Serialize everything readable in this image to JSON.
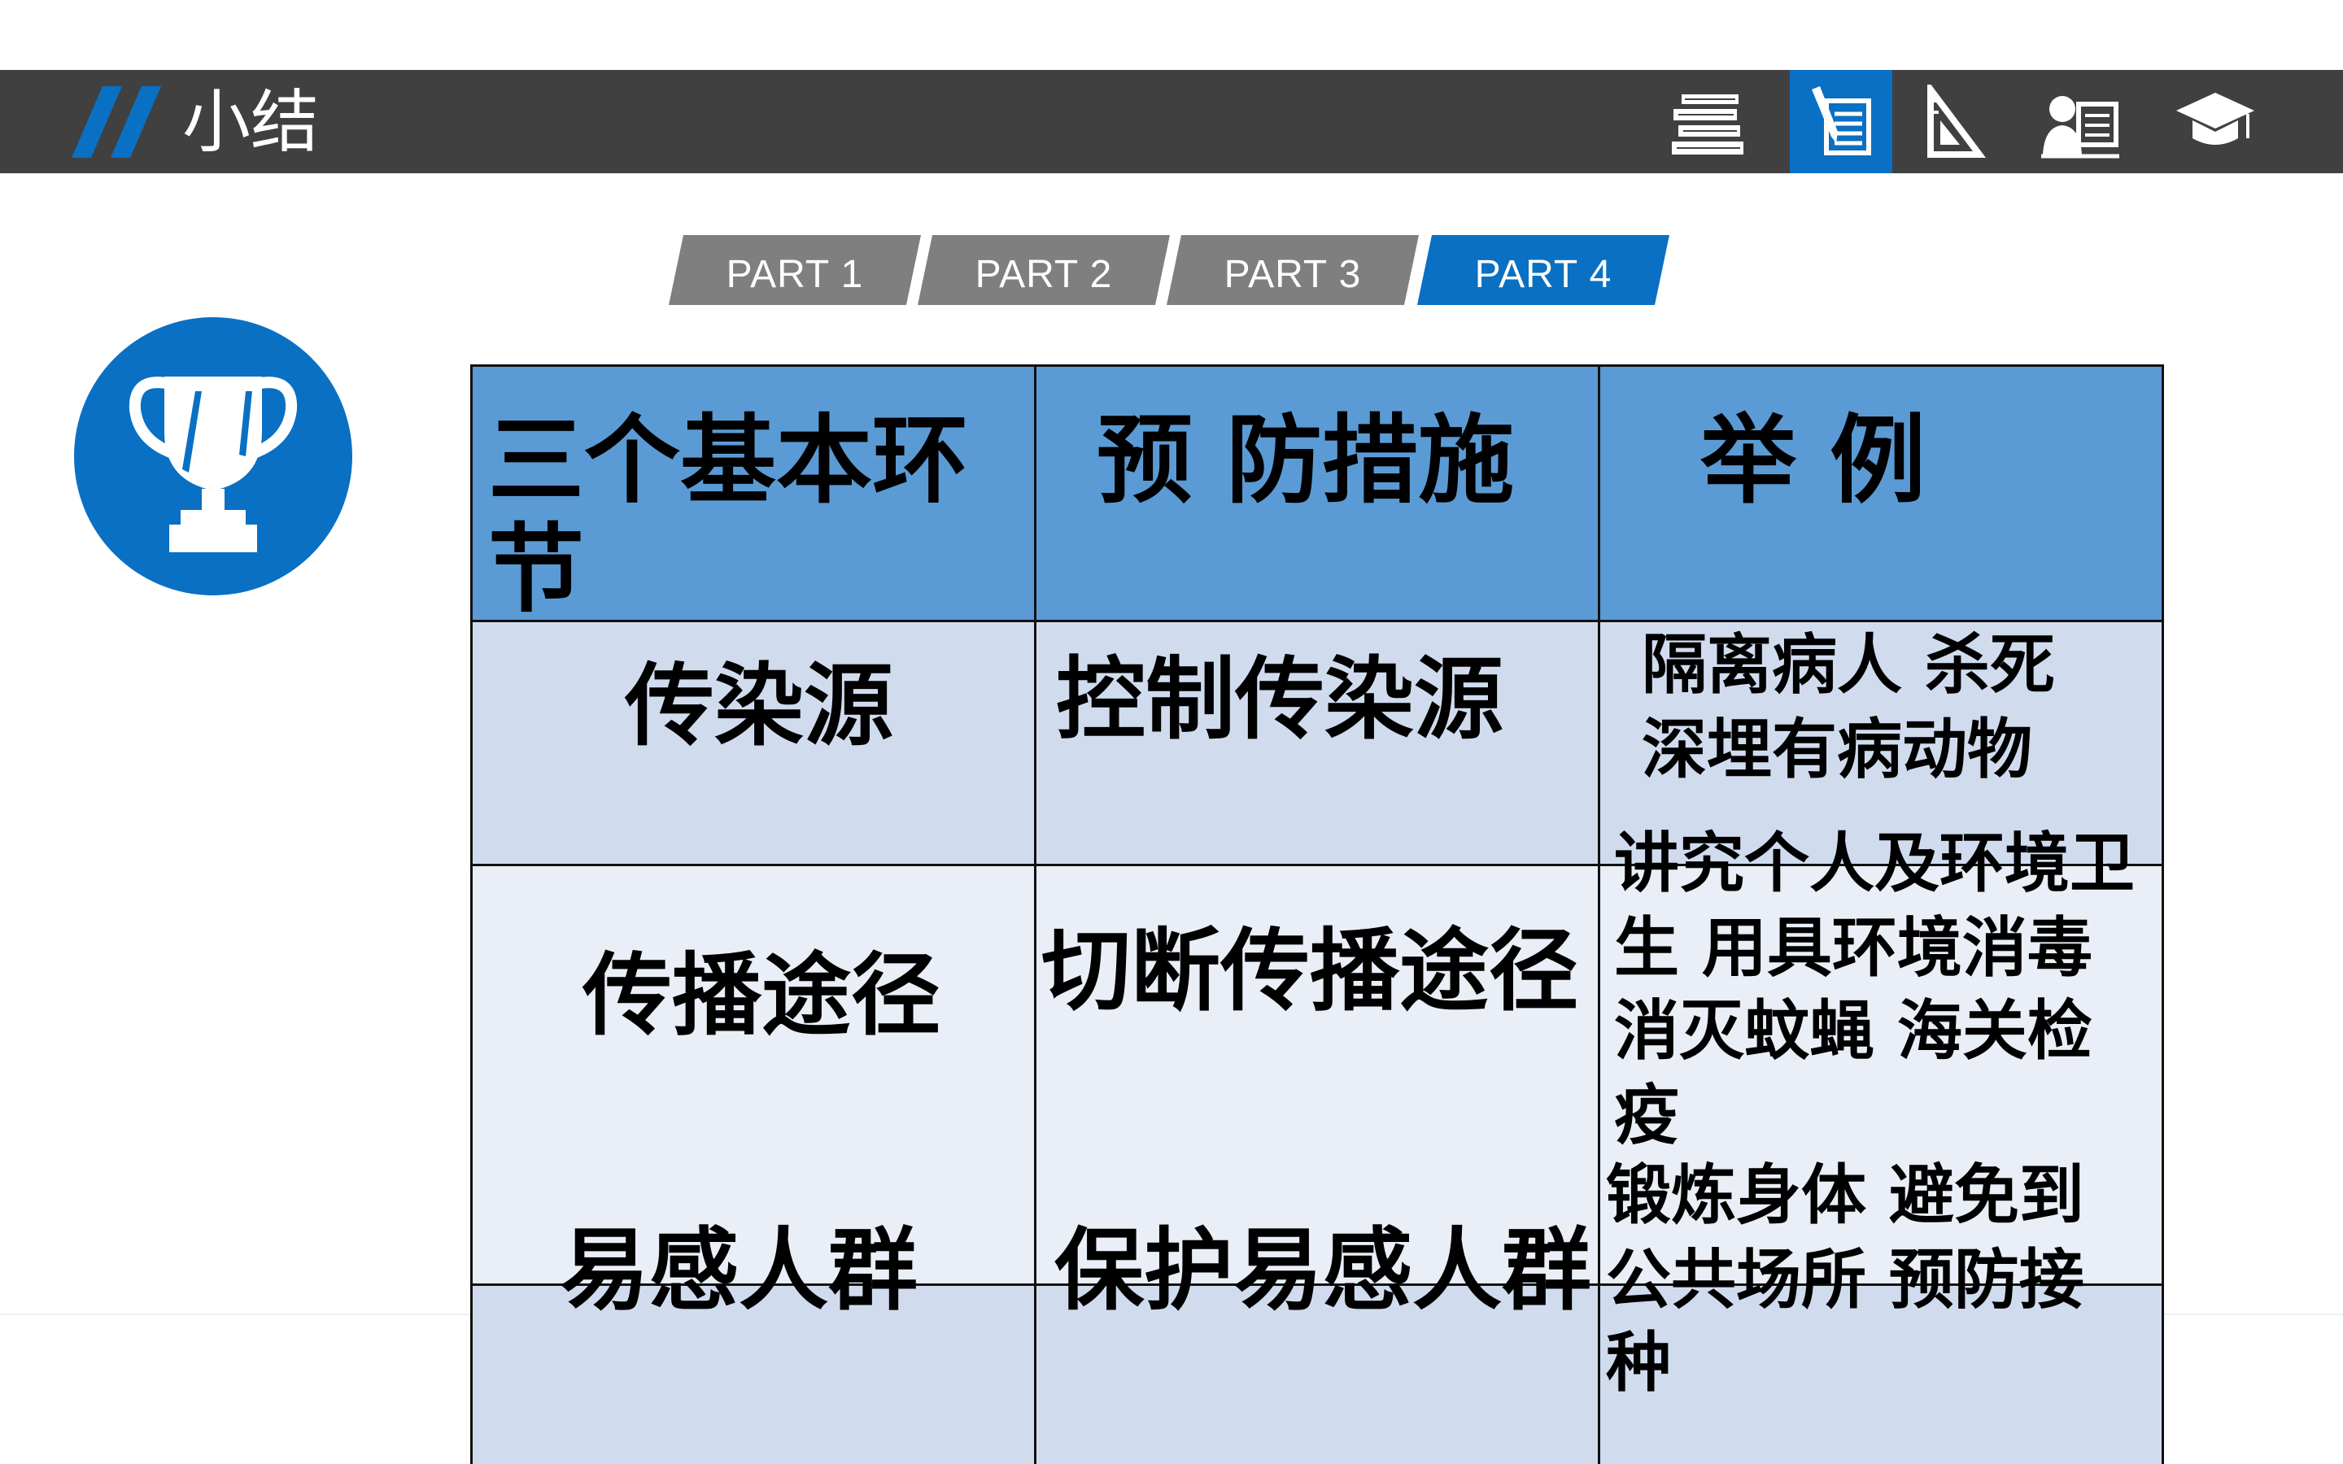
{
  "header": {
    "title": "小结",
    "nav_icons": [
      "books-icon",
      "notes-pencil-icon",
      "ruler-triangle-icon",
      "teacher-board-icon",
      "graduation-cap-icon"
    ],
    "active_icon": "notes-pencil-icon"
  },
  "parts": {
    "tabs": [
      "PART 1",
      "PART 2",
      "PART 3",
      "PART 4"
    ],
    "active": "PART 4"
  },
  "colors": {
    "bar": "#404040",
    "accent": "#0a70c3",
    "tab_inactive": "#7f7f7f",
    "table_header": "#5b9bd5",
    "table_row_dark": "#d0dcee",
    "table_row_light": "#e9eef7"
  },
  "decor": {
    "badge_icon": "trophy-icon"
  },
  "table": {
    "headers": {
      "col1_line1": "三个基本环",
      "col1_line2": "节",
      "col2": "预 防措施",
      "col3": "举 例"
    },
    "row1": {
      "link": "传染源",
      "measure": "控制传染源",
      "example_line1": "隔离病人 杀死",
      "example_line2": "深埋有病动物"
    },
    "row2": {
      "link": "传播途径",
      "measure": "切断传播途径",
      "example_lines": [
        "讲究个人及环境卫",
        "生 用具环境消毒",
        "消灭蚊蝇  海关检",
        "疫"
      ]
    },
    "row3": {
      "link": "易感人群",
      "measure": "保护易感人群",
      "example_lines": [
        "锻炼身体  避免到",
        "公共场所 预防接",
        "种"
      ]
    }
  }
}
